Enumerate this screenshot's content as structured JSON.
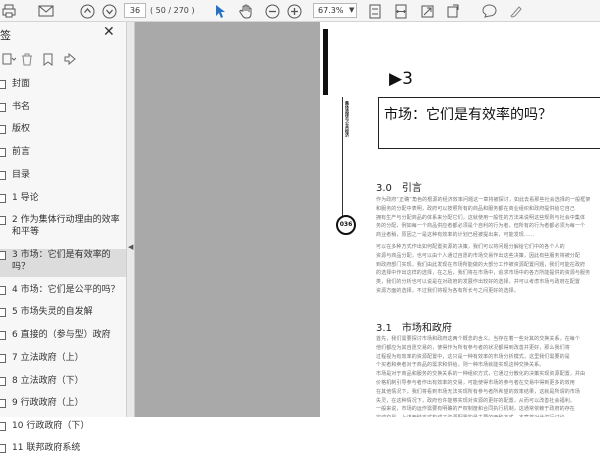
{
  "toolbar": {
    "page_current": "36",
    "page_count": "( 50 / 270 )",
    "zoom": "67.3%",
    "icons": [
      "print-icon",
      "email-icon",
      "prev-page-icon",
      "next-page-icon",
      "select-cursor-icon",
      "hand-tool-icon",
      "zoom-out-icon",
      "zoom-in-icon",
      "fit-page-icon",
      "fit-width-icon",
      "full-screen-icon",
      "rotate-icon",
      "comment-icon",
      "highlight-icon"
    ]
  },
  "sidebar": {
    "title": "签",
    "items": [
      {
        "label": "封面"
      },
      {
        "label": "书名"
      },
      {
        "label": "版权"
      },
      {
        "label": "前言"
      },
      {
        "label": "目录"
      },
      {
        "label": "1 导论"
      },
      {
        "label": "2 作为集体行动理由的效率和平等"
      },
      {
        "label": "3 市场：它们是有效率的吗？",
        "selected": true
      },
      {
        "label": "4 市场：它们是公平的吗？"
      },
      {
        "label": "5 市场失灵的自发解"
      },
      {
        "label": "6 直接的（参与型）政府"
      },
      {
        "label": "7 立法政府（上）"
      },
      {
        "label": "8 立法政府（下）"
      },
      {
        "label": "9 行政政府（上）"
      },
      {
        "label": "10 行政政府（下）"
      },
      {
        "label": "11 联邦政府系统"
      }
    ]
  },
  "document": {
    "side_title": "集体选择与公共经济",
    "page_number": "036",
    "chapter": "▶3",
    "chapter_title": "市场：它们是有效率的吗？",
    "section1": "3.0　引言",
    "section2": "3.1　市场和政府",
    "para1": [
      "作为政府“正确”角色的根源的经济效率问题这一章将被探讨，如此去看那些社会选择的一般框架",
      "和服务的分配中表明，政府可以按照所有的商品和服务都在商业组织和政府提供给它自己",
      "拥有生产与分配商品的体系来分配它们，这就使用一般性的方法来说明这些规则与社会中集体",
      "务的分配，例如每一个商品供应者都必须是个自利的行为者，但所有的行为者都必须为每一个",
      "商业者稍，原因之一是这种有效率的计划已经被提出来，可能发现……"
    ],
    "para2": [
      "可以在多种方式作出如何配置资源的决策，我们可以将问题分解给它们中的各个人的",
      "资源与商品分配，也可以由个人通过自愿的市场交易作出这些决策，因此有些服务将被分配",
      "到政府部门实现，我们由此发现在市场所能做的大部分工作被资源配置问题，我们可能在政府",
      "的选择中作出这样的选择，在之后，我们将在市场中，追求市场中的各方所能提供的资源与服务",
      "类，我们的分析也可以说是在对政府的发展作出较好的选择，并可以考虑市场与政府在配置",
      "资源方面的选择，不过我们将视为各有所长与之间更好的选择。"
    ],
    "para3": [
      "首先，我们需要探讨市场和政府这两个概念的含义。当存在着一些对其的交换关系，在每个",
      "他们都应为其自愿交易的，使得作为所有参与者的状况都得到改善并更好，那么我们将",
      "过程视为有效率的资源配置中，这只是一种有效率的市场分析模式，这里我们需要的是",
      "个买者和卖者对于商品的需求和供给，则一种市场就能实现这种交换关系。",
      "市场是对于商品和服务的交换关系的一种组织方式，它通过分散化的决策实现资源配置，并由",
      "价格机制引导参与者作出有效率的交易，可能使得市场的参与者在交易中得到更多的效用",
      "在其他情况下，我们将看到市场无法实现所有参与者所希望的效率结果，这就是所谓的市场",
      "失灵，在这种情况下，政府也许能够实现对资源的更好的配置，从而可以改善社会福利。",
      "一般来说，市场的运作需要有明确的产权制度和合同执行机制，这通常依赖于政府的存在",
      "完成交易，上述两种方式构成了资源配置的最主要的两种方式，本章将对此进行讨论。"
    ]
  }
}
